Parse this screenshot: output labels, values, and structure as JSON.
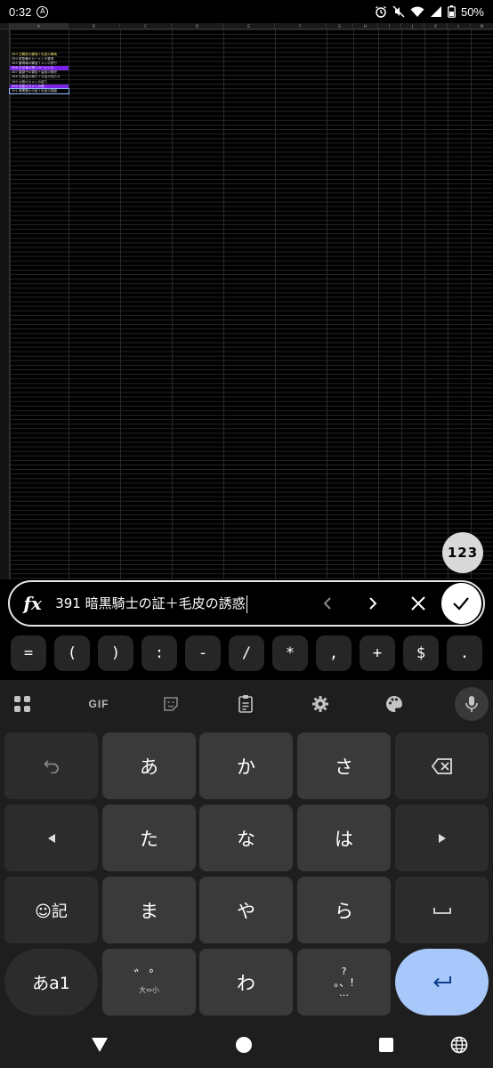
{
  "status": {
    "time": "0:32",
    "battery": "50%"
  },
  "sheet": {
    "columns": [
      "A",
      "B",
      "C",
      "D",
      "E",
      "F",
      "G",
      "H",
      "I",
      "J",
      "K",
      "L",
      "M",
      "N"
    ],
    "cells": [
      {
        "text": "383 白鷹蛇の鱗瑞＋毛皮の舞後",
        "style": "yellow"
      },
      {
        "text": "384 蒼藍輪のカーメンの雲漫",
        "style": "normal"
      },
      {
        "text": "385 雷鳴竜の鱗宝＋メンの誇り",
        "style": "normal"
      },
      {
        "text": "386 天空竜の銀＋カーメンの",
        "style": "purple"
      },
      {
        "text": "387 聖獣子の雲紋＋姿紋の輝光",
        "style": "normal"
      },
      {
        "text": "388 白鳳皇の鉤爪＋宇由の知らせ",
        "style": "normal"
      },
      {
        "text": "389 大陸のカメンの姿り",
        "style": "normal"
      },
      {
        "text": "390 流星のカメンの尾",
        "style": "purple"
      },
      {
        "text": "391 暗黒騎士の証＋毛皮の誘惑",
        "style": "active"
      }
    ]
  },
  "badge": "123",
  "formula": {
    "value": "391 暗黒騎士の証＋毛皮の誘惑"
  },
  "symbols": [
    "=",
    "(",
    ")",
    ":",
    "-",
    "/",
    "*",
    ",",
    "+",
    "$",
    "."
  ],
  "keyboard": {
    "toolbar_gif": "GIF",
    "keys": {
      "a": "あ",
      "ka": "か",
      "sa": "さ",
      "ta": "た",
      "na": "な",
      "ha": "は",
      "emoji": "☺記",
      "ma": "ま",
      "ya": "や",
      "ra": "ら",
      "mode": "あa1",
      "dakuten": "゛゜",
      "dakuten_sub": "大⇔小",
      "wa": "わ",
      "punct_top": "?",
      "punct_mid": "。、!",
      "punct_bottom": "…"
    }
  }
}
